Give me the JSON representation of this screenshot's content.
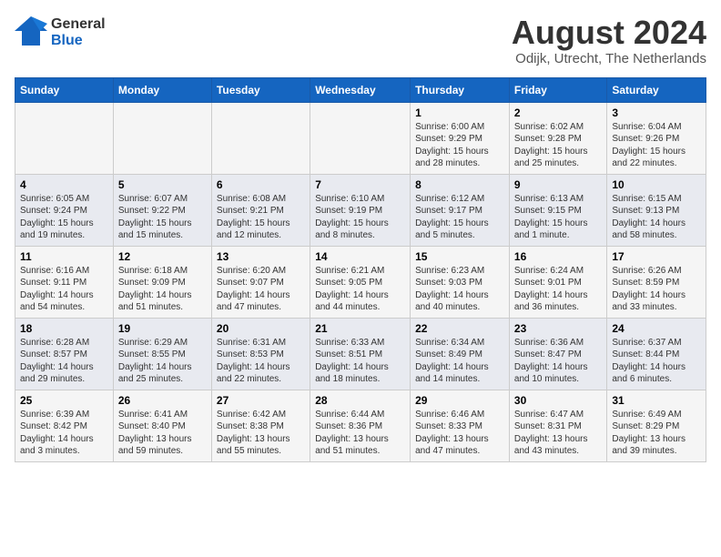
{
  "header": {
    "logo_general": "General",
    "logo_blue": "Blue",
    "title": "August 2024",
    "subtitle": "Odijk, Utrecht, The Netherlands"
  },
  "calendar": {
    "days_of_week": [
      "Sunday",
      "Monday",
      "Tuesday",
      "Wednesday",
      "Thursday",
      "Friday",
      "Saturday"
    ],
    "weeks": [
      [
        {
          "day": "",
          "text": ""
        },
        {
          "day": "",
          "text": ""
        },
        {
          "day": "",
          "text": ""
        },
        {
          "day": "",
          "text": ""
        },
        {
          "day": "1",
          "text": "Sunrise: 6:00 AM\nSunset: 9:29 PM\nDaylight: 15 hours and 28 minutes."
        },
        {
          "day": "2",
          "text": "Sunrise: 6:02 AM\nSunset: 9:28 PM\nDaylight: 15 hours and 25 minutes."
        },
        {
          "day": "3",
          "text": "Sunrise: 6:04 AM\nSunset: 9:26 PM\nDaylight: 15 hours and 22 minutes."
        }
      ],
      [
        {
          "day": "4",
          "text": "Sunrise: 6:05 AM\nSunset: 9:24 PM\nDaylight: 15 hours and 19 minutes."
        },
        {
          "day": "5",
          "text": "Sunrise: 6:07 AM\nSunset: 9:22 PM\nDaylight: 15 hours and 15 minutes."
        },
        {
          "day": "6",
          "text": "Sunrise: 6:08 AM\nSunset: 9:21 PM\nDaylight: 15 hours and 12 minutes."
        },
        {
          "day": "7",
          "text": "Sunrise: 6:10 AM\nSunset: 9:19 PM\nDaylight: 15 hours and 8 minutes."
        },
        {
          "day": "8",
          "text": "Sunrise: 6:12 AM\nSunset: 9:17 PM\nDaylight: 15 hours and 5 minutes."
        },
        {
          "day": "9",
          "text": "Sunrise: 6:13 AM\nSunset: 9:15 PM\nDaylight: 15 hours and 1 minute."
        },
        {
          "day": "10",
          "text": "Sunrise: 6:15 AM\nSunset: 9:13 PM\nDaylight: 14 hours and 58 minutes."
        }
      ],
      [
        {
          "day": "11",
          "text": "Sunrise: 6:16 AM\nSunset: 9:11 PM\nDaylight: 14 hours and 54 minutes."
        },
        {
          "day": "12",
          "text": "Sunrise: 6:18 AM\nSunset: 9:09 PM\nDaylight: 14 hours and 51 minutes."
        },
        {
          "day": "13",
          "text": "Sunrise: 6:20 AM\nSunset: 9:07 PM\nDaylight: 14 hours and 47 minutes."
        },
        {
          "day": "14",
          "text": "Sunrise: 6:21 AM\nSunset: 9:05 PM\nDaylight: 14 hours and 44 minutes."
        },
        {
          "day": "15",
          "text": "Sunrise: 6:23 AM\nSunset: 9:03 PM\nDaylight: 14 hours and 40 minutes."
        },
        {
          "day": "16",
          "text": "Sunrise: 6:24 AM\nSunset: 9:01 PM\nDaylight: 14 hours and 36 minutes."
        },
        {
          "day": "17",
          "text": "Sunrise: 6:26 AM\nSunset: 8:59 PM\nDaylight: 14 hours and 33 minutes."
        }
      ],
      [
        {
          "day": "18",
          "text": "Sunrise: 6:28 AM\nSunset: 8:57 PM\nDaylight: 14 hours and 29 minutes."
        },
        {
          "day": "19",
          "text": "Sunrise: 6:29 AM\nSunset: 8:55 PM\nDaylight: 14 hours and 25 minutes."
        },
        {
          "day": "20",
          "text": "Sunrise: 6:31 AM\nSunset: 8:53 PM\nDaylight: 14 hours and 22 minutes."
        },
        {
          "day": "21",
          "text": "Sunrise: 6:33 AM\nSunset: 8:51 PM\nDaylight: 14 hours and 18 minutes."
        },
        {
          "day": "22",
          "text": "Sunrise: 6:34 AM\nSunset: 8:49 PM\nDaylight: 14 hours and 14 minutes."
        },
        {
          "day": "23",
          "text": "Sunrise: 6:36 AM\nSunset: 8:47 PM\nDaylight: 14 hours and 10 minutes."
        },
        {
          "day": "24",
          "text": "Sunrise: 6:37 AM\nSunset: 8:44 PM\nDaylight: 14 hours and 6 minutes."
        }
      ],
      [
        {
          "day": "25",
          "text": "Sunrise: 6:39 AM\nSunset: 8:42 PM\nDaylight: 14 hours and 3 minutes."
        },
        {
          "day": "26",
          "text": "Sunrise: 6:41 AM\nSunset: 8:40 PM\nDaylight: 13 hours and 59 minutes."
        },
        {
          "day": "27",
          "text": "Sunrise: 6:42 AM\nSunset: 8:38 PM\nDaylight: 13 hours and 55 minutes."
        },
        {
          "day": "28",
          "text": "Sunrise: 6:44 AM\nSunset: 8:36 PM\nDaylight: 13 hours and 51 minutes."
        },
        {
          "day": "29",
          "text": "Sunrise: 6:46 AM\nSunset: 8:33 PM\nDaylight: 13 hours and 47 minutes."
        },
        {
          "day": "30",
          "text": "Sunrise: 6:47 AM\nSunset: 8:31 PM\nDaylight: 13 hours and 43 minutes."
        },
        {
          "day": "31",
          "text": "Sunrise: 6:49 AM\nSunset: 8:29 PM\nDaylight: 13 hours and 39 minutes."
        }
      ]
    ]
  }
}
